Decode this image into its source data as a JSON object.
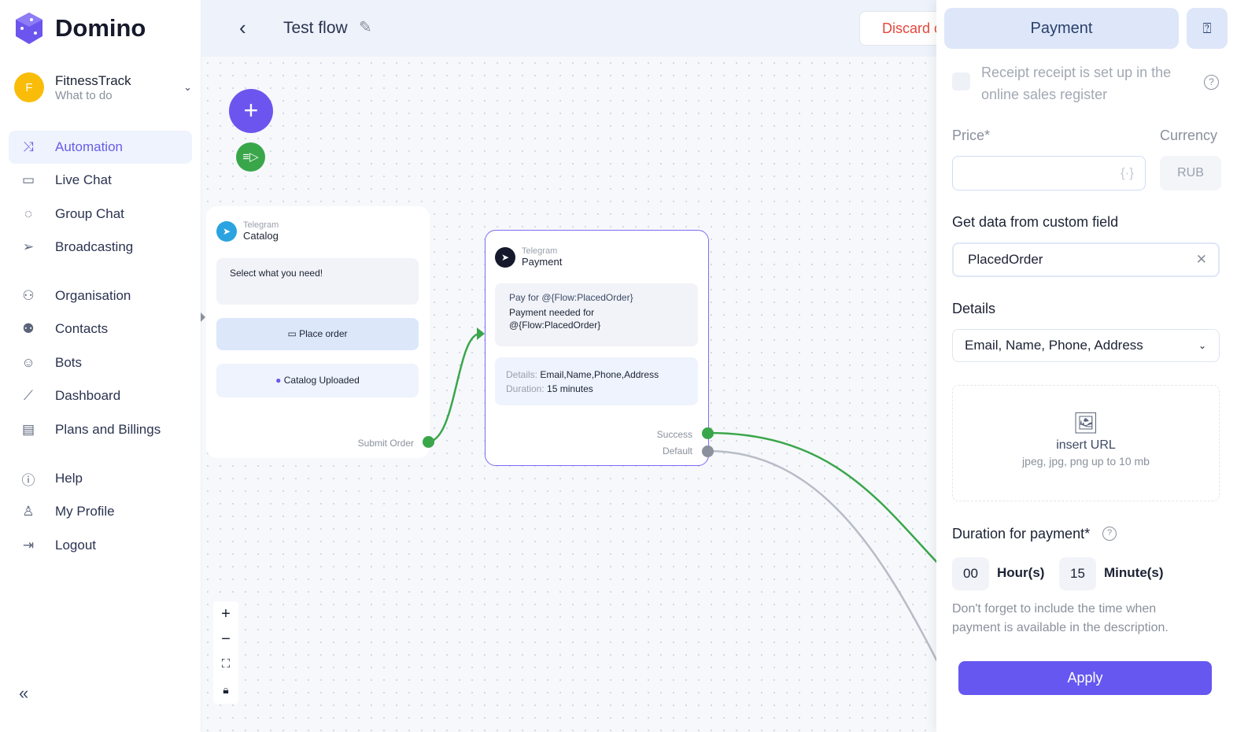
{
  "brand": {
    "name": "Domino",
    "accent": "#6c55ee"
  },
  "workspace": {
    "initial": "F",
    "name": "FitnessTrack",
    "subtitle": "What to do"
  },
  "sidebar": {
    "items": [
      {
        "label": "Automation",
        "icon": "shuffle-icon",
        "active": true
      },
      {
        "label": "Live Chat",
        "icon": "chat-icon"
      },
      {
        "label": "Group Chat",
        "icon": "group-chat-icon"
      },
      {
        "label": "Broadcasting",
        "icon": "send-icon"
      },
      {
        "label": "Organisation",
        "icon": "organisation-icon"
      },
      {
        "label": "Contacts",
        "icon": "contacts-icon"
      },
      {
        "label": "Bots",
        "icon": "bot-icon"
      },
      {
        "label": "Dashboard",
        "icon": "chart-icon"
      },
      {
        "label": "Plans and Billings",
        "icon": "billing-icon"
      },
      {
        "label": "Help",
        "icon": "help-icon"
      },
      {
        "label": "My Profile",
        "icon": "profile-icon"
      },
      {
        "label": "Logout",
        "icon": "logout-icon"
      }
    ]
  },
  "header": {
    "title": "Test flow",
    "discard_label": "Discard changes"
  },
  "nodes": {
    "catalog": {
      "channel": "Telegram",
      "title": "Catalog",
      "message": "Select what you need!",
      "button1": "Place order",
      "button2": "Catalog Uploaded",
      "port": "Submit Order"
    },
    "payment": {
      "channel": "Telegram",
      "title": "Payment",
      "line1": "Pay for @{Flow:PlacedOrder}",
      "line2": "Payment needed for @{Flow:PlacedOrder}",
      "details_label": "Details:",
      "details_value": "Email,Name,Phone,Address",
      "duration_label": "Duration:",
      "duration_value": "15 minutes",
      "port_success": "Success",
      "port_default": "Default"
    }
  },
  "zoom_controls": {
    "zoom_in": "+",
    "zoom_out": "−"
  },
  "panel": {
    "title": "Payment",
    "receipt_label": "Receipt receipt is set up in the online sales register",
    "price_label": "Price*",
    "price_value": "",
    "currency_label": "Currency",
    "currency_value": "RUB",
    "custom_field_label": "Get data from custom field",
    "custom_field_value": "PlacedOrder",
    "details_label": "Details",
    "details_value": "Email, Name, Phone, Address",
    "upload_label": "insert URL",
    "upload_hint": "jpeg, jpg, png up to 10 mb",
    "duration_label": "Duration for payment*",
    "hours": "00",
    "hours_label": "Hour(s)",
    "minutes": "15",
    "minutes_label": "Minute(s)",
    "note": "Don't forget to include the time when payment is available in the description.",
    "apply_label": "Apply"
  },
  "colors": {
    "success": "#3aa64a",
    "default": "#8a909c",
    "discard": "#e4473b"
  }
}
